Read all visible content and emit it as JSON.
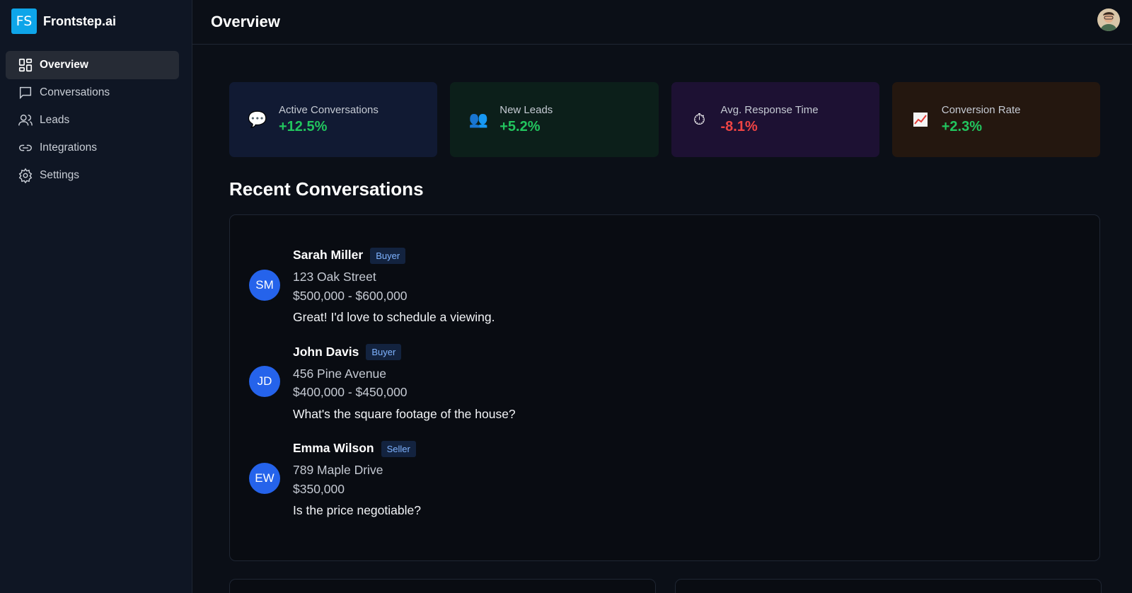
{
  "brand": {
    "logo_text": "FS",
    "name": "Frontstep.ai"
  },
  "sidebar": {
    "items": [
      {
        "label": "Overview",
        "icon": "grid-icon",
        "active": true
      },
      {
        "label": "Conversations",
        "icon": "chat-icon",
        "active": false
      },
      {
        "label": "Leads",
        "icon": "users-icon",
        "active": false
      },
      {
        "label": "Integrations",
        "icon": "link-icon",
        "active": false
      },
      {
        "label": "Settings",
        "icon": "gear-icon",
        "active": false
      }
    ]
  },
  "header": {
    "title": "Overview",
    "avatar_icon": "user-avatar"
  },
  "stats": [
    {
      "label": "Active Conversations",
      "value": "+12.5%",
      "icon": "speech-bubble-icon",
      "trend": "up"
    },
    {
      "label": "New Leads",
      "value": "+5.2%",
      "icon": "people-icon",
      "trend": "up"
    },
    {
      "label": "Avg. Response Time",
      "value": "-8.1%",
      "icon": "stopwatch-icon",
      "trend": "down"
    },
    {
      "label": "Conversion Rate",
      "value": "+2.3%",
      "icon": "chart-up-icon",
      "trend": "up"
    }
  ],
  "recent": {
    "title": "Recent Conversations",
    "items": [
      {
        "initials": "SM",
        "name": "Sarah Miller",
        "role": "Buyer",
        "address": "123 Oak Street",
        "price": "$500,000 - $600,000",
        "message": "Great! I'd love to schedule a viewing."
      },
      {
        "initials": "JD",
        "name": "John Davis",
        "role": "Buyer",
        "address": "456 Pine Avenue",
        "price": "$400,000 - $450,000",
        "message": "What's the square footage of the house?"
      },
      {
        "initials": "EW",
        "name": "Emma Wilson",
        "role": "Seller",
        "address": "789 Maple Drive",
        "price": "$350,000",
        "message": "Is the price negotiable?"
      }
    ]
  },
  "colors": {
    "accent": "#2563eb",
    "positive": "#22c55e",
    "negative": "#ef4444",
    "brand": "#0ea5e9"
  }
}
